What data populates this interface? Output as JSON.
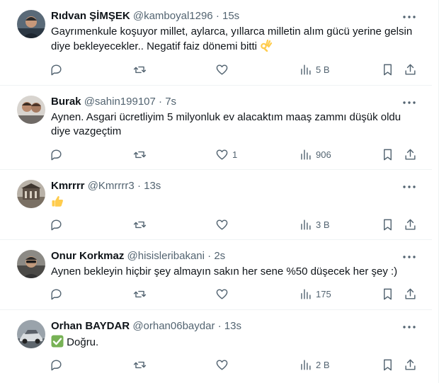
{
  "tweets": [
    {
      "name": "Rıdvan ŞİMŞEK",
      "handle": "@kamboyal1296",
      "sep": "·",
      "time": "15s",
      "text": "Gayrımenkule koşuyor millet, aylarca, yıllarca milletin alım gücü yerine gelsin diye bekleyecekler.. Negatif faiz dönemi bitti",
      "emoji": "ok-hand",
      "replies": "",
      "retweets": "",
      "likes": "",
      "views": "5 B"
    },
    {
      "name": "Burak",
      "handle": "@sahin199107",
      "sep": "·",
      "time": "7s",
      "text": "Aynen. Asgari ücretliyim 5 milyonluk ev alacaktım maaş zammı düşük oldu diye vazgeçtim",
      "emoji": "",
      "replies": "",
      "retweets": "",
      "likes": "1",
      "views": "906"
    },
    {
      "name": "Kmrrrr",
      "handle": "@Kmrrrr3",
      "sep": "·",
      "time": "13s",
      "text": "",
      "emoji": "thumbs-up",
      "replies": "",
      "retweets": "",
      "likes": "",
      "views": "3 B"
    },
    {
      "name": "Onur Korkmaz",
      "handle": "@hisisleribakani",
      "sep": "·",
      "time": "2s",
      "text": "Aynen bekleyin hiçbir şey almayın sakın her sene %50 düşecek her şey :)",
      "emoji": "",
      "replies": "",
      "retweets": "",
      "likes": "",
      "views": "175"
    },
    {
      "name": "Orhan BAYDAR",
      "handle": "@orhan06baydar",
      "sep": "·",
      "time": "13s",
      "text": "Doğru.",
      "emoji": "check-mark",
      "replies": "",
      "retweets": "",
      "likes": "",
      "views": "2 B"
    }
  ],
  "colors": {
    "text": "#0f1419",
    "muted": "#536471",
    "divider": "#eff3f4",
    "check": "#77b255",
    "emoji": "#ffcc4d"
  }
}
